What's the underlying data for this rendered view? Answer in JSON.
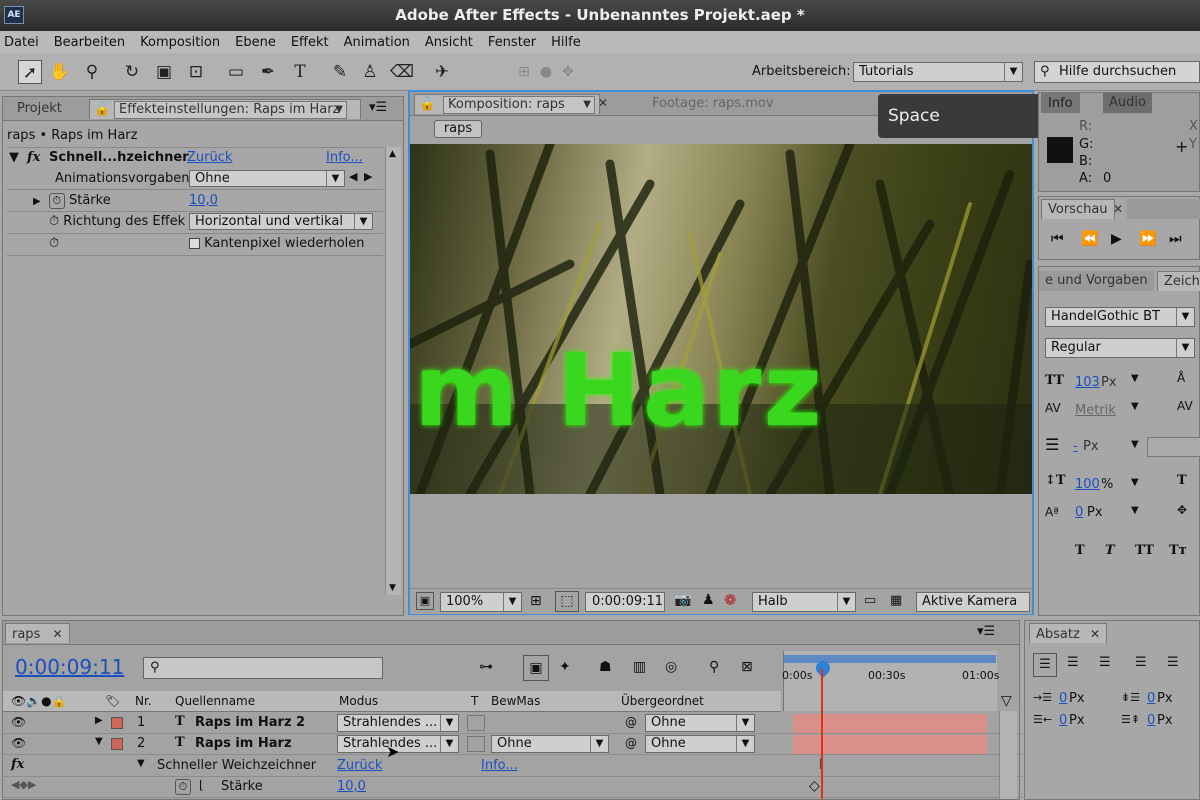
{
  "window": {
    "title": "Adobe After Effects - Unbenanntes Projekt.aep *",
    "logo": "AE"
  },
  "menu": [
    "Datei",
    "Bearbeiten",
    "Komposition",
    "Ebene",
    "Effekt",
    "Animation",
    "Ansicht",
    "Fenster",
    "Hilfe"
  ],
  "toolbar": {
    "workspace_label": "Arbeitsbereich:",
    "workspace_value": "Tutorials",
    "search_placeholder": "Hilfe durchsuchen"
  },
  "effects_panel": {
    "tab_project": "Projekt",
    "tab_effects": "Effekteinstellungen: Raps im Harz",
    "breadcrumb": "raps • Raps im Harz",
    "effect_name": "Schnell...hzeichner",
    "fx_label": "fx",
    "reset": "Zurück",
    "info": "Info...",
    "preset_label": "Animationsvorgaben:",
    "preset_value": "Ohne",
    "strength_label": "Stärke",
    "strength_value": "10,0",
    "direction_label": "Richtung des Effek",
    "direction_value": "Horizontal und vertikal",
    "repeat_label": "Kantenpixel wiederholen"
  },
  "comp_panel": {
    "tab_comp": "Komposition: raps",
    "tab_footage": "Footage: raps.mov",
    "flow_button": "raps",
    "overlay_text": "m Harz",
    "zoom": "100%",
    "timecode": "0:00:09:11",
    "resolution": "Halb",
    "camera": "Aktive Kamera"
  },
  "tooltip": "Space",
  "info_panel": {
    "tab_info": "Info",
    "tab_audio": "Audio",
    "r": "R:",
    "g": "G:",
    "b": "B:",
    "a": "A:",
    "a_value": "0",
    "x": "X",
    "y": "Y"
  },
  "preview_panel": {
    "tab": "Vorschau"
  },
  "character_panel": {
    "tab_presets": "e und Vorgaben",
    "tab_char": "Zeiche",
    "font": "HandelGothic BT",
    "style": "Regular",
    "size": "103",
    "size_unit": "Px",
    "kerning": "Metrik",
    "leading": "-",
    "leading_unit": "Px",
    "vscale": "100",
    "vscale_unit": "%",
    "baseline": "0",
    "baseline_unit": "Px",
    "styles": [
      "T",
      "T",
      "TT",
      "Tт"
    ]
  },
  "timeline": {
    "tab": "raps",
    "timecode": "0:00:09:11",
    "columns": {
      "nr": "Nr.",
      "source": "Quellenname",
      "mode": "Modus",
      "t": "T",
      "trkmat": "BewMas",
      "parent": "Übergeordnet"
    },
    "layers": [
      {
        "nr": "1",
        "name": "Raps im Harz 2",
        "mode": "Strahlendes ...",
        "parent": "Ohne",
        "color": "#d0655a"
      },
      {
        "nr": "2",
        "name": "Raps im Harz",
        "mode": "Strahlendes ...",
        "trkmat": "Ohne",
        "parent": "Ohne",
        "color": "#d0655a"
      }
    ],
    "effect_row": {
      "name": "Schneller Weichzeichner",
      "reset": "Zurück",
      "info": "Info..."
    },
    "strength_row": {
      "label": "Stärke",
      "value": "10,0"
    },
    "ruler": [
      "0:00s",
      "00:30s",
      "01:00s"
    ]
  },
  "paragraph_panel": {
    "tab": "Absatz",
    "indent_left": "0",
    "indent_right": "0",
    "space_before": "0",
    "space_after": "0",
    "unit": "Px"
  },
  "colors": {
    "accent_blue": "#1a4fc0",
    "text_green": "#39d81f",
    "layer_bar": "#d9908a",
    "cti_red": "#e0301e"
  }
}
